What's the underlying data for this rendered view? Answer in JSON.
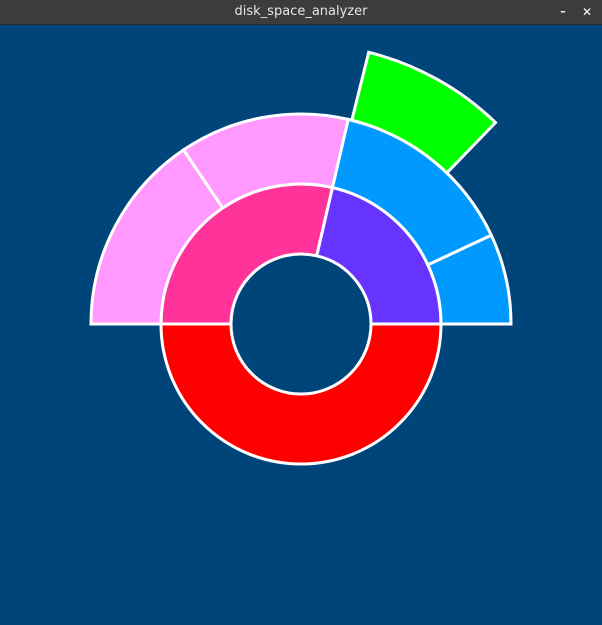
{
  "window": {
    "title": "disk_space_analyzer",
    "minimize_icon": "minimize-icon",
    "close_icon": "close-icon",
    "minimize_glyph": "–",
    "close_glyph": "✕"
  },
  "colors": {
    "background": "#00457a",
    "stroke": "#ffffff"
  },
  "sunburst": {
    "rings": [
      {
        "level": 1,
        "segments": [
          {
            "start_deg": 0,
            "end_deg": 180,
            "color": "#ff0000",
            "label": ""
          },
          {
            "start_deg": 180,
            "end_deg": 283,
            "color": "#ff3399",
            "label": ""
          },
          {
            "start_deg": 283,
            "end_deg": 360,
            "color": "#6633ff",
            "label": ""
          }
        ]
      },
      {
        "level": 2,
        "segments": [
          {
            "start_deg": 180,
            "end_deg": 236,
            "color": "#ff99ff",
            "label": ""
          },
          {
            "start_deg": 236,
            "end_deg": 283,
            "color": "#ff99ff",
            "label": ""
          },
          {
            "start_deg": 283,
            "end_deg": 335,
            "color": "#0099ff",
            "label": ""
          },
          {
            "start_deg": 335,
            "end_deg": 360,
            "color": "#0099ff",
            "label": ""
          }
        ]
      },
      {
        "level": 3,
        "segments": [
          {
            "start_deg": 284,
            "end_deg": 314,
            "color": "#00ff00",
            "label": ""
          }
        ]
      }
    ]
  }
}
